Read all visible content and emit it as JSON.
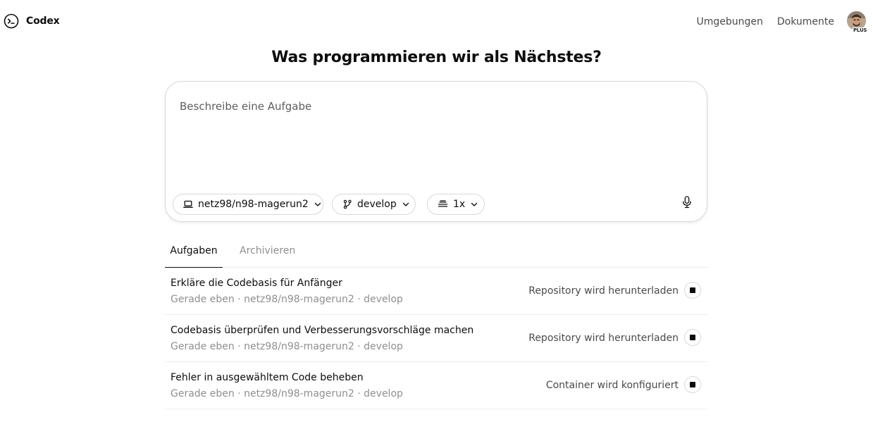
{
  "header": {
    "logo_text": "Codex",
    "nav": {
      "environments": "Umgebungen",
      "docs": "Dokumente"
    },
    "avatar_badge": "PLUS"
  },
  "main": {
    "headline": "Was programmieren wir als Nächstes?",
    "prompt": {
      "placeholder": "Beschreibe eine Aufgabe",
      "repo": "netz98/n98-magerun2",
      "branch": "develop",
      "count": "1x"
    },
    "tabs": [
      {
        "label": "Aufgaben",
        "active": true
      },
      {
        "label": "Archivieren",
        "active": false
      }
    ],
    "tasks": [
      {
        "title": "Erkläre die Codebasis für Anfänger",
        "meta": "Gerade eben · netz98/n98-magerun2 · develop",
        "status": "Repository wird herunterladen"
      },
      {
        "title": "Codebasis überprüfen und Verbesserungsvorschläge machen",
        "meta": "Gerade eben · netz98/n98-magerun2 · develop",
        "status": "Repository wird herunterladen"
      },
      {
        "title": "Fehler in ausgewähltem Code beheben",
        "meta": "Gerade eben · netz98/n98-magerun2 · develop",
        "status": "Container wird konfiguriert"
      }
    ]
  },
  "icons": {
    "logo": "terminal-circle-icon",
    "repo": "laptop-icon",
    "branch": "git-branch-icon",
    "count": "stack-icon",
    "chevron": "chevron-down-icon",
    "mic": "microphone-icon",
    "stop": "stop-icon"
  },
  "colors": {
    "text": "#0d0d0d",
    "muted": "#8f8f8f",
    "border": "#d9d9d9"
  }
}
